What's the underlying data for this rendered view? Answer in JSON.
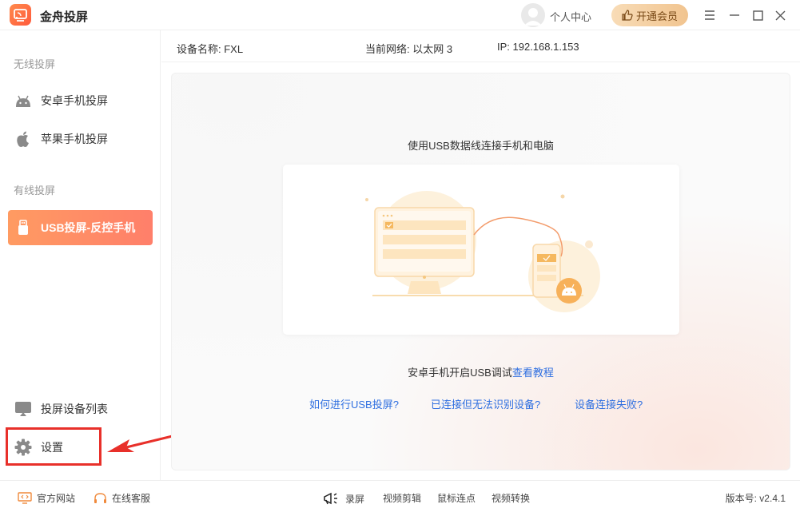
{
  "app": {
    "title": "金舟投屏",
    "logo_icon": "cast-icon"
  },
  "header": {
    "user_center": "个人中心",
    "vip_label": "开通会员",
    "accent": "#ff7f5c"
  },
  "sidebar": {
    "wireless_title": "无线投屏",
    "wired_title": "有线投屏",
    "items": [
      {
        "label": "安卓手机投屏",
        "icon": "android-icon"
      },
      {
        "label": "苹果手机投屏",
        "icon": "apple-icon"
      },
      {
        "label": "USB投屏-反控手机",
        "icon": "usb-icon",
        "active": true
      }
    ],
    "bottom_items": [
      {
        "label": "投屏设备列表",
        "icon": "screen-list-icon"
      },
      {
        "label": "设置",
        "icon": "gear-icon"
      }
    ]
  },
  "info": {
    "device_name": "设备名称: FXL",
    "network": "当前网络:  以太网 3",
    "ip": "IP: 192.168.1.153"
  },
  "main": {
    "heading": "使用USB数据线连接手机和电脑",
    "hint_prefix": "安卓手机开启USB调试",
    "hint_link": "查看教程",
    "faq": [
      "如何进行USB投屏?",
      "已连接但无法识别设备?",
      "设备连接失败?"
    ]
  },
  "footer": {
    "website": "官方网站",
    "support": "在线客服",
    "tools": [
      "录屏",
      "视频剪辑",
      "鼠标连点",
      "视频转换"
    ],
    "version": "版本号: v2.4.1"
  }
}
